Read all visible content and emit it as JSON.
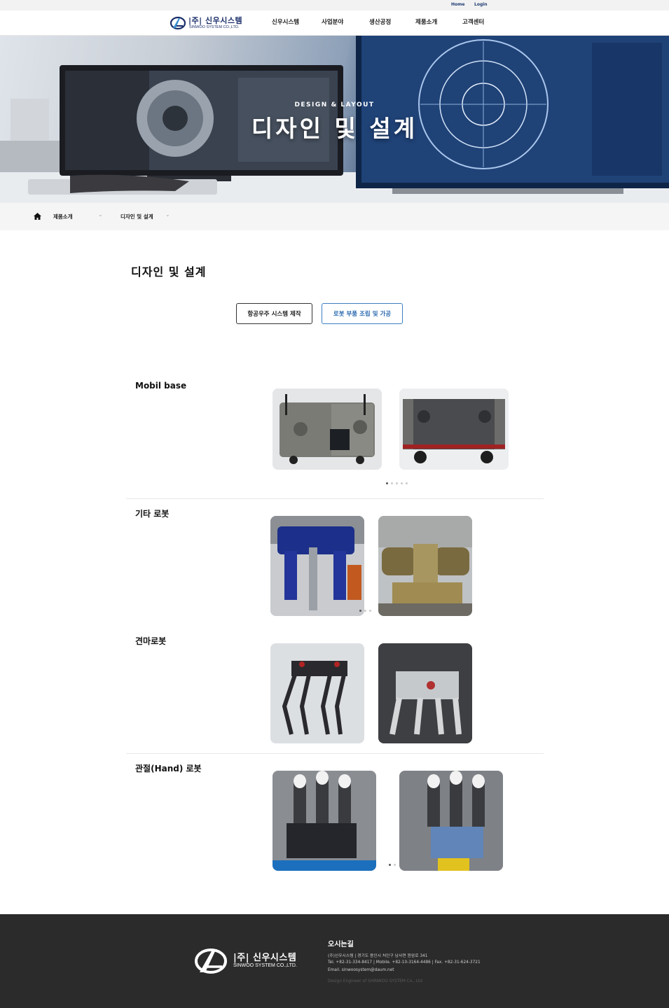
{
  "topbar": {
    "home": "Home",
    "login": "Login"
  },
  "header": {
    "logo_name": "|주| 신우시스템",
    "logo_sub": "SINWOO SYSTEM CO.,LTD.",
    "nav": [
      "신우시스템",
      "사업분야",
      "생산공정",
      "제품소개",
      "고객센터"
    ]
  },
  "hero": {
    "eyebrow": "DESIGN & LAYOUT",
    "title": "디자인 및 설계"
  },
  "breadcrumb": {
    "items": [
      "제품소개",
      "디자인 및 설계"
    ]
  },
  "page_title": "디자인 및 설계",
  "tabs": [
    "항공우주 시스템 제작",
    "로봇 부품 조립 및 가공"
  ],
  "sections": [
    {
      "title": "Mobil base",
      "dots": 5,
      "active_dot": 0
    },
    {
      "title": "기타 로봇",
      "dots": 3,
      "active_dot": 0
    },
    {
      "title": "견마로봇",
      "dots": 0,
      "active_dot": 0
    },
    {
      "title": "관절(Hand) 로봇",
      "dots": 2,
      "active_dot": 0
    }
  ],
  "footer": {
    "logo_name": "|주| 신우시스템",
    "logo_sub": "SINWOO SYSTEM CO.,LTD.",
    "heading": "오시는길",
    "address_line": "(주)신우시스템   |   경기도 용인시 처인구 남사면 원암로 341",
    "contact_line": "Tel. +82-31-334-8417   |   Mobile. +82-10-3164-4486   |   Fax. +82-31-624-3721",
    "email_line": "Email. sinwoosystem@daum.net",
    "copyright": "Design Engineer of SHINWOO SYSTEM Co., Ltd"
  },
  "colors": {
    "brand_navy": "#1b2f6b",
    "tab_blue": "#3f7fc0",
    "footer_bg": "#2b2b2b"
  }
}
